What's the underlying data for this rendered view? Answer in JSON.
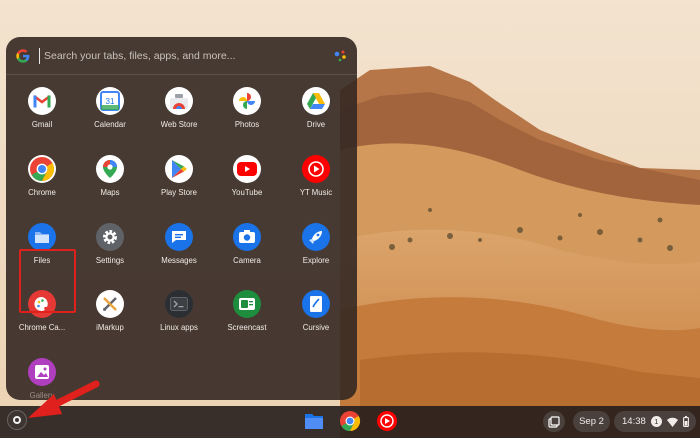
{
  "search": {
    "placeholder": "Search your tabs, files, apps, and more..."
  },
  "apps": [
    {
      "label": "Gmail",
      "icon": "gmail-icon"
    },
    {
      "label": "Calendar",
      "icon": "calendar-icon"
    },
    {
      "label": "Web Store",
      "icon": "web-store-icon"
    },
    {
      "label": "Photos",
      "icon": "photos-icon"
    },
    {
      "label": "Drive",
      "icon": "drive-icon"
    },
    {
      "label": "Chrome",
      "icon": "chrome-icon"
    },
    {
      "label": "Maps",
      "icon": "maps-icon"
    },
    {
      "label": "Play Store",
      "icon": "play-store-icon"
    },
    {
      "label": "YouTube",
      "icon": "youtube-icon"
    },
    {
      "label": "YT Music",
      "icon": "yt-music-icon"
    },
    {
      "label": "Files",
      "icon": "files-icon"
    },
    {
      "label": "Settings",
      "icon": "settings-icon"
    },
    {
      "label": "Messages",
      "icon": "messages-icon"
    },
    {
      "label": "Camera",
      "icon": "camera-icon"
    },
    {
      "label": "Explore",
      "icon": "explore-icon"
    },
    {
      "label": "Chrome Ca...",
      "icon": "chrome-canvas-icon"
    },
    {
      "label": "iMarkup",
      "icon": "imarkup-icon"
    },
    {
      "label": "Linux apps",
      "icon": "linux-apps-icon"
    },
    {
      "label": "Screencast",
      "icon": "screencast-icon"
    },
    {
      "label": "Cursive",
      "icon": "cursive-icon"
    },
    {
      "label": "Gallery",
      "icon": "gallery-icon"
    }
  ],
  "highlighted_app": "Files",
  "calendar_day": "31",
  "shelf": {
    "pinned": [
      "Files",
      "Chrome",
      "YT Music"
    ],
    "date": "Sep 2",
    "time": "14:38",
    "notification_count": "1"
  },
  "colors": {
    "highlight_box": "#e0201c",
    "arrow": "#e0201c",
    "launcher_bg": "#342822"
  }
}
